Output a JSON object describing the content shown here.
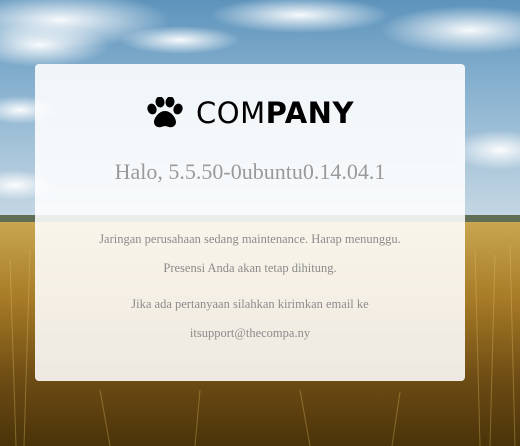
{
  "brand": {
    "icon": "paw-icon",
    "name_light": "COM",
    "name_bold": "PANY"
  },
  "greeting": "Halo, 5.5.50-0ubuntu0.14.04.1",
  "messages": {
    "line1": "Jaringan perusahaan sedang maintenance. Harap menunggu.",
    "line2": "Presensi Anda akan tetap dihitung.",
    "line3": "Jika ada pertanyaan silahkan kirimkan email ke",
    "line4": "itsupport@thecompa.ny"
  },
  "colors": {
    "card_background": "#ffffff",
    "greeting_text": "#9a9a9a",
    "message_text": "#8c8c8c",
    "logo_text": "#000000"
  }
}
